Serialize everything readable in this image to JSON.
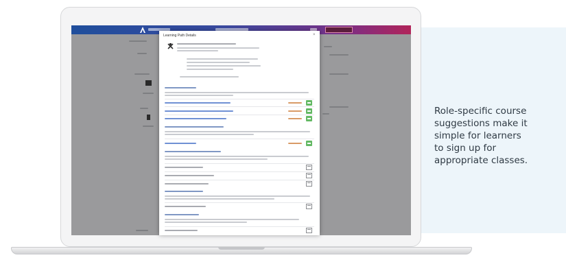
{
  "caption": {
    "line1": "Role-specific course",
    "line2": "suggestions make it",
    "line3": "simple for learners",
    "line4": "to sign up for",
    "line5": "appropriate classes."
  },
  "modal": {
    "title": "Learning Path Details",
    "close_glyph": "×"
  },
  "icons": {
    "logo": "app-logo-icon",
    "course": "course-item-icon",
    "add": "add-icon",
    "calendar": "calendar-icon",
    "close": "close-icon"
  },
  "colors": {
    "topbar_start": "#1f4e9c",
    "topbar_end": "#b1245a",
    "add_button": "#64b964",
    "caption_text": "#2f3a44",
    "panel_bg": "#edf5fa"
  }
}
